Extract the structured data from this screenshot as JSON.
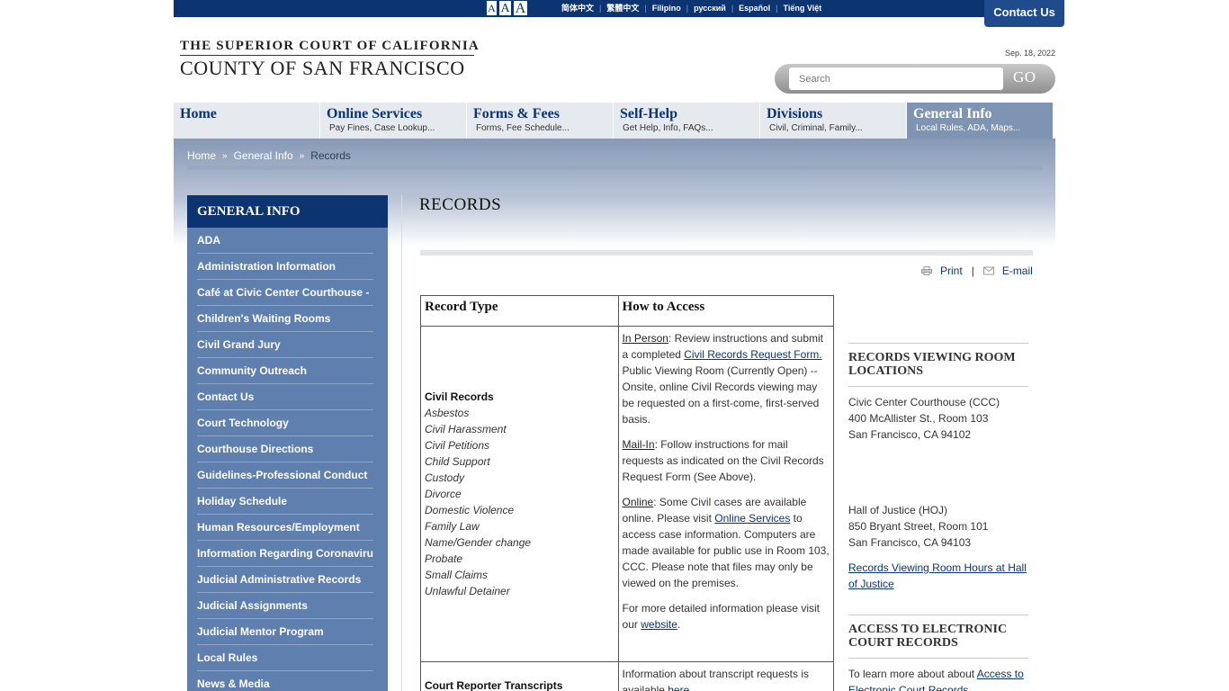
{
  "topbar": {
    "font_sizes": [
      "A",
      "A",
      "A"
    ],
    "languages": [
      "简体中文",
      "繁體中文",
      "Filipino",
      "русский",
      "Español",
      "Tiếng Việt"
    ],
    "contact_label": "Contact Us"
  },
  "header": {
    "logo_line1": "THE SUPERIOR COURT OF CALIFORNIA",
    "logo_line2": "COUNTY OF SAN FRANCISCO",
    "date": "Sep. 18, 2022",
    "search_placeholder": "Search",
    "search_button": "GO"
  },
  "nav": [
    {
      "title": "Home",
      "sub": ""
    },
    {
      "title": "Online Services",
      "sub": "Pay Fines, Case Lookup..."
    },
    {
      "title": "Forms & Fees",
      "sub": "Forms, Fee Schedule..."
    },
    {
      "title": "Self-Help",
      "sub": "Get Help, Info, FAQs..."
    },
    {
      "title": "Divisions",
      "sub": "Civil, Criminal, Family..."
    },
    {
      "title": "General Info",
      "sub": "Local Rules, ADA, Maps..."
    }
  ],
  "breadcrumb": {
    "home": "Home",
    "section": "General Info",
    "current": "Records",
    "sep": "»"
  },
  "sidebar": {
    "title": "GENERAL INFO",
    "items": [
      "ADA",
      "Administration Information",
      "Café at Civic Center Courthouse -",
      "Children's Waiting Rooms",
      "Civil Grand Jury",
      "Community Outreach",
      "Contact Us",
      "Court Technology",
      "Courthouse Directions",
      "Guidelines-Professional Conduct",
      "Holiday Schedule",
      "Human Resources/Employment",
      "Information Regarding Coronavirus",
      "Judicial Administrative Records",
      "Judicial Assignments",
      "Judicial Mentor Program",
      "Local Rules",
      "News & Media"
    ]
  },
  "main": {
    "title": "RECORDS",
    "print": "Print",
    "email": "E-mail",
    "table": {
      "headers": [
        "Record Type",
        "How to Access"
      ],
      "civil": {
        "label": "Civil Records",
        "types": [
          "Asbestos",
          "Civil Harassment",
          "Civil Petitions",
          "Child Support",
          "Custody",
          "Divorce",
          "Domestic Violence",
          "Family Law",
          "Name/Gender change",
          "Probate",
          "Small Claims",
          "Unlawful Detainer"
        ],
        "in_person_label": "In Person",
        "in_person_a": ": Review instructions and submit a completed ",
        "in_person_link": "Civil Records Request Form.",
        "in_person_b": " Public Viewing Room (Currently Open) -- Onsite, online Civil Records viewing may be requested on a first-come, first-served basis.",
        "mail_label": "Mail-In",
        "mail_text": ": Follow instructions for mail requests as indicated on the Civil Records Request Form (See Above).",
        "online_label": "Online",
        "online_a": ": Some Civil cases are available online. Please visit ",
        "online_link": "Online Services",
        "online_b": " to access case information. Computers are made available for public use in Room 103, CCC. Please note that files may only be viewed on the premises.",
        "more_a": "For more detailed information please visit our ",
        "more_link": "website",
        "more_b": "."
      },
      "transcripts": {
        "label": "Court Reporter Transcripts",
        "text_a": "Information about transcript requests is available ",
        "text_link": "here",
        "text_b": "."
      }
    }
  },
  "right": {
    "h1": "RECORDS VIEWING ROOM LOCATIONS",
    "ccc": [
      "Civic Center Courthouse (CCC)",
      "400 McAllister St., Room 103",
      "San Francisco, CA  94102"
    ],
    "hoj": [
      "Hall of Justice (HOJ)",
      "850 Bryant Street, Room 101",
      "San Francisco, CA  94103"
    ],
    "hoj_link": "Records Viewing Room Hours at Hall of Justice",
    "h2": "ACCESS TO ELECTRONIC COURT RECORDS",
    "ecr_a": "To learn more about about ",
    "ecr_link": "Access to Electronic Court Records"
  }
}
